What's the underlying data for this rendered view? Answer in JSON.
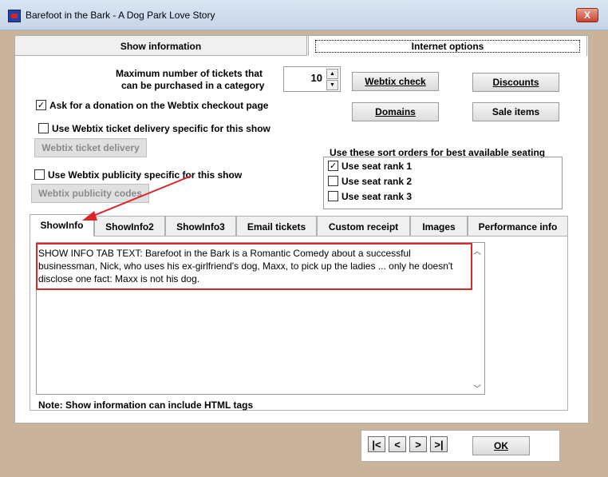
{
  "window": {
    "title": "Barefoot in the Bark - A Dog Park Love Story",
    "close_label": "X"
  },
  "top_tabs": [
    "Show information",
    "Internet options"
  ],
  "tickets": {
    "label_line1": "Maximum number of tickets that",
    "label_line2": "can be purchased in a category",
    "value": "10"
  },
  "buttons": {
    "webtix_check": "Webtix check",
    "discounts": "Discounts",
    "domains": "Domains",
    "sale_items": "Sale items",
    "webtix_ticket_delivery": "Webtix ticket delivery",
    "webtix_publicity_codes": "Webtix publicity codes",
    "ok": "OK"
  },
  "checkboxes": {
    "donation": {
      "label": "Ask for a donation on the Webtix checkout page",
      "checked": true
    },
    "delivery": {
      "label": "Use Webtix ticket delivery specific for this show",
      "checked": false
    },
    "publicity": {
      "label": "Use Webtix publicity specific for this show",
      "checked": false
    }
  },
  "seating": {
    "title": "Use these sort orders for best available seating",
    "ranks": [
      {
        "label": "Use seat rank 1",
        "checked": true
      },
      {
        "label": "Use seat rank 2",
        "checked": false
      },
      {
        "label": "Use seat rank 3",
        "checked": false
      }
    ]
  },
  "lower_tabs": [
    "ShowInfo",
    "ShowInfo2",
    "ShowInfo3",
    "Email tickets",
    "Custom receipt",
    "Images",
    "Performance info"
  ],
  "show_info_text": "SHOW INFO TAB TEXT: Barefoot in the Bark is a Romantic Comedy about a successful businessman, Nick, who uses his ex-girlfriend's dog, Maxx, to pick up the ladies ... only he doesn't disclose one fact: Maxx is not his dog.",
  "note": "Note: Show information can include HTML tags",
  "nav": {
    "first": "|<",
    "prev": "<",
    "next": ">",
    "last": ">|"
  },
  "colors": {
    "background": "#c9b49b",
    "annotation_red": "#d9262a"
  }
}
